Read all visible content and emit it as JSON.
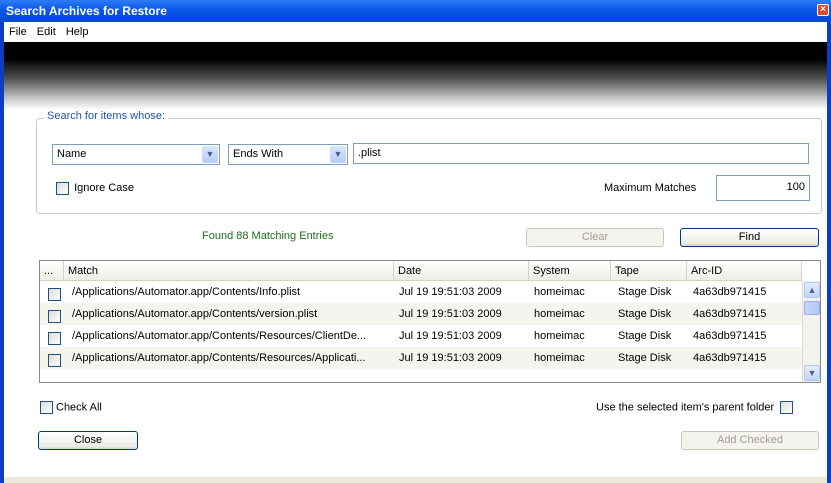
{
  "window": {
    "title": "Search Archives for Restore",
    "close_glyph": "×"
  },
  "menu": [
    "File",
    "Edit",
    "Help"
  ],
  "search": {
    "legend": "Search for items whose:",
    "field": "Name",
    "operator": "Ends With",
    "value": ".plist",
    "ignore_case_label": "Ignore Case",
    "ignore_case_checked": false,
    "max_matches_label": "Maximum Matches",
    "max_matches_value": "100"
  },
  "status": {
    "found_text": "Found 88 Matching Entries"
  },
  "buttons": {
    "clear": "Clear",
    "find": "Find",
    "close": "Close",
    "add_checked": "Add Checked"
  },
  "table": {
    "columns": [
      "...",
      "Match",
      "Date",
      "System",
      "Tape",
      "Arc-ID"
    ],
    "rows": [
      {
        "checked": false,
        "match": "/Applications/Automator.app/Contents/Info.plist",
        "date": "Jul 19 19:51:03 2009",
        "system": "homeimac",
        "tape": "Stage Disk",
        "arc_id": "4a63db971415"
      },
      {
        "checked": false,
        "match": "/Applications/Automator.app/Contents/version.plist",
        "date": "Jul 19 19:51:03 2009",
        "system": "homeimac",
        "tape": "Stage Disk",
        "arc_id": "4a63db971415"
      },
      {
        "checked": false,
        "match": "/Applications/Automator.app/Contents/Resources/ClientDe...",
        "date": "Jul 19 19:51:03 2009",
        "system": "homeimac",
        "tape": "Stage Disk",
        "arc_id": "4a63db971415"
      },
      {
        "checked": false,
        "match": "/Applications/Automator.app/Contents/Resources/Applicati...",
        "date": "Jul 19 19:51:03 2009",
        "system": "homeimac",
        "tape": "Stage Disk",
        "arc_id": "4a63db971415"
      }
    ]
  },
  "footer": {
    "check_all_label": "Check All",
    "parent_folder_label": "Use the selected item's parent folder"
  },
  "icons": {
    "dropdown_arrow": "chevron-down-icon",
    "scroll_up": "arrow-up-icon",
    "scroll_down": "arrow-down-icon"
  }
}
